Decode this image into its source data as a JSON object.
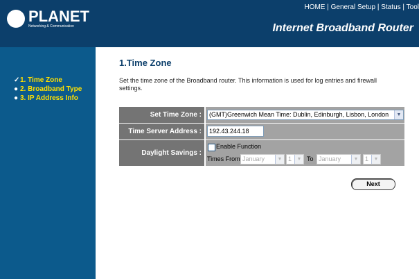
{
  "header": {
    "logo_text": "PLANET",
    "logo_sub": "Networking & Communication",
    "nav": [
      "HOME",
      "General Setup",
      "Status",
      "Tool"
    ],
    "nav_sep": "|",
    "product_title": "Internet Broadband Router"
  },
  "sidebar": {
    "items": [
      {
        "label": "1. Time Zone",
        "marker": "check-icon"
      },
      {
        "label": "2. Broadband Type",
        "marker": "bullet-icon"
      },
      {
        "label": "3. IP Address Info",
        "marker": "bullet-icon"
      }
    ]
  },
  "main": {
    "title": "1.Time Zone",
    "description": "Set the time zone of the Broadband router. This information is used for log entries and firewall settings.",
    "time_zone_label": "Set Time Zone :",
    "time_zone_value": "(GMT)Greenwich Mean Time: Dublin, Edinburgh, Lisbon, London",
    "time_server_label": "Time Server Address :",
    "time_server_value": "192.43.244.18",
    "daylight_label": "Daylight Savings :",
    "enable_label": "Enable Function",
    "enable_checked": false,
    "times_from_label": "Times From",
    "from_month": "January",
    "from_day": "1",
    "to_label": "To",
    "to_month": "January",
    "to_day": "1",
    "next_label": "Next"
  },
  "colors": {
    "header_bg": "#0c3f6b",
    "sidebar_bg": "#0c5a8c",
    "sidebar_text": "#ffe000",
    "label_bg": "#747474",
    "value_bg": "#a3a3a3"
  }
}
